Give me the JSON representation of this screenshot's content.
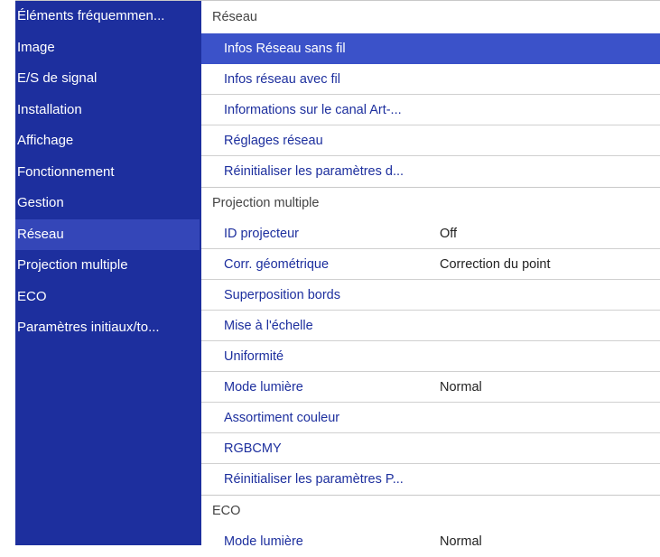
{
  "sidebar": {
    "items": [
      {
        "label": "Éléments fréquemmen..."
      },
      {
        "label": "Image"
      },
      {
        "label": "E/S de signal"
      },
      {
        "label": "Installation"
      },
      {
        "label": "Affichage"
      },
      {
        "label": "Fonctionnement"
      },
      {
        "label": "Gestion"
      },
      {
        "label": "Réseau"
      },
      {
        "label": "Projection multiple"
      },
      {
        "label": "ECO"
      },
      {
        "label": "Paramètres initiaux/to..."
      }
    ],
    "active_index": 7
  },
  "sections": {
    "network": {
      "title": "Réseau",
      "items": [
        {
          "label": "Infos Réseau sans fil"
        },
        {
          "label": "Infos réseau avec fil"
        },
        {
          "label": "Informations sur le canal Art-..."
        },
        {
          "label": "Réglages réseau"
        },
        {
          "label": "Réinitialiser les paramètres d..."
        }
      ]
    },
    "multi": {
      "title": "Projection multiple",
      "items": [
        {
          "label": "ID projecteur",
          "value": "Off"
        },
        {
          "label": "Corr. géométrique",
          "value": "Correction du point"
        },
        {
          "label": "Superposition bords",
          "value": ""
        },
        {
          "label": "Mise à l'échelle",
          "value": ""
        },
        {
          "label": "Uniformité",
          "value": ""
        },
        {
          "label": "Mode lumière",
          "value": "Normal"
        },
        {
          "label": "Assortiment couleur",
          "value": ""
        },
        {
          "label": "RGBCMY",
          "value": ""
        },
        {
          "label": "Réinitialiser les paramètres P...",
          "value": ""
        }
      ]
    },
    "eco": {
      "title": "ECO",
      "items": [
        {
          "label": "Mode lumière",
          "value": "Normal"
        }
      ]
    }
  },
  "colors": {
    "sidebar_bg": "#1d2f9e",
    "sidebar_active": "#3446b8",
    "selection": "#3b52c9",
    "link_text": "#1d2f9e"
  }
}
